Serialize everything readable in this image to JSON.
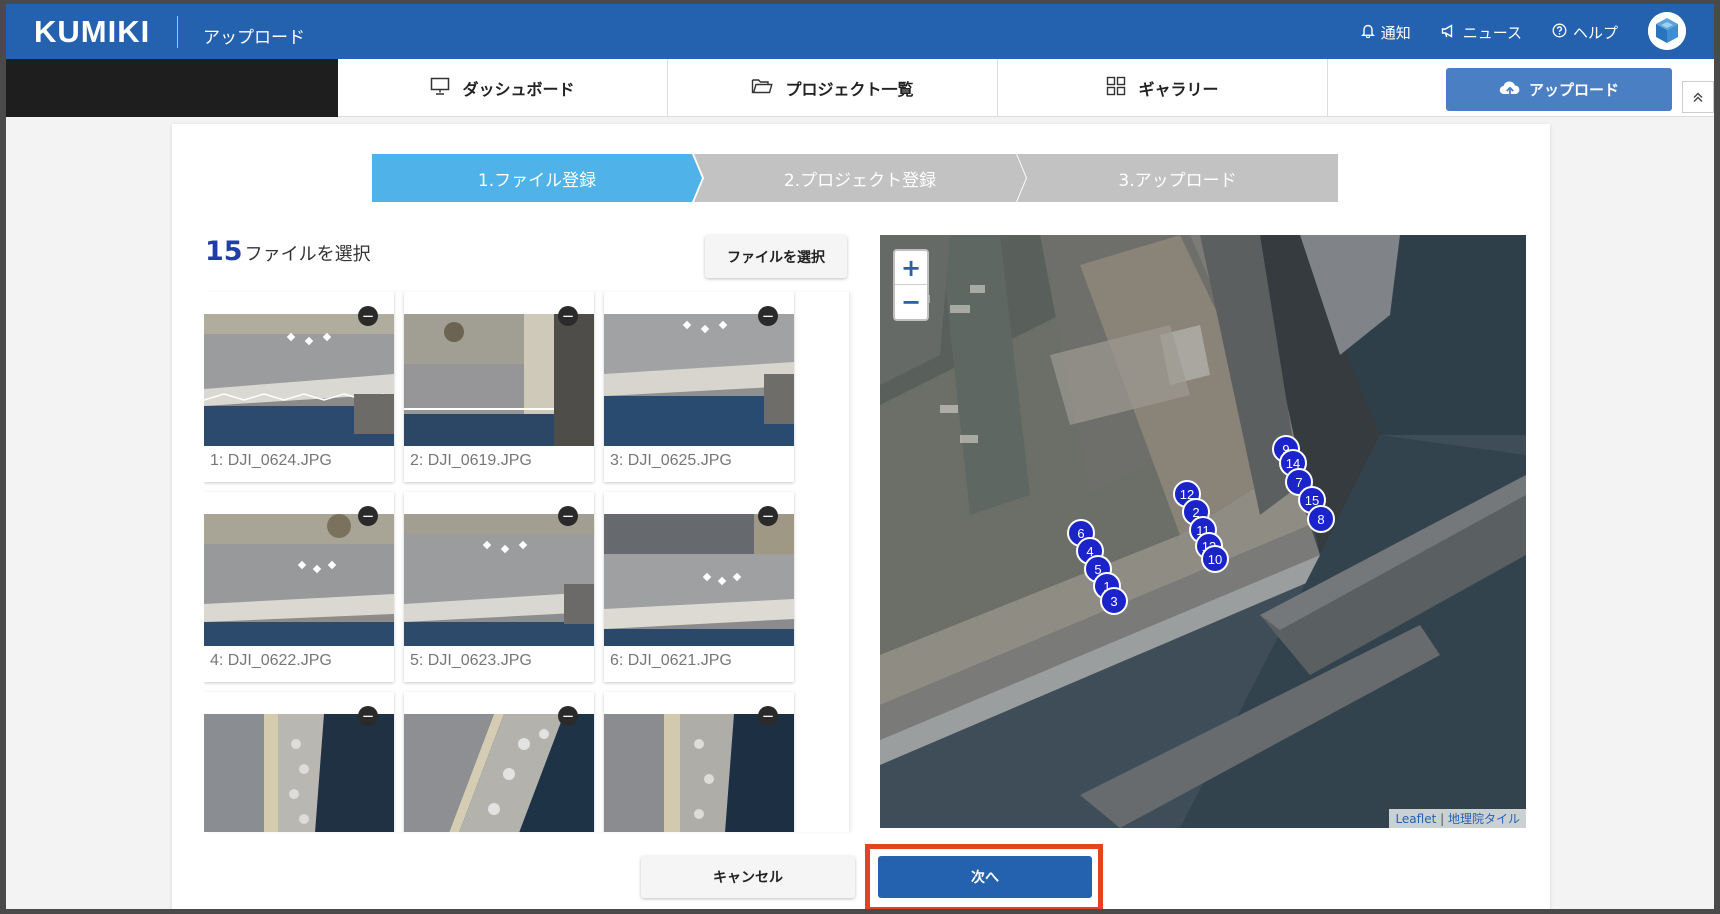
{
  "header": {
    "logo": "KUMIKI",
    "page_name": "アップロード",
    "links": [
      {
        "label": "通知",
        "icon": "bell-icon"
      },
      {
        "label": "ニュース",
        "icon": "megaphone-icon"
      },
      {
        "label": "ヘルプ",
        "icon": "help-circle-icon"
      }
    ]
  },
  "nav": {
    "tabs": [
      {
        "label": "ダッシュボード",
        "icon": "monitor-icon"
      },
      {
        "label": "プロジェクト一覧",
        "icon": "folder-icon"
      },
      {
        "label": "ギャラリー",
        "icon": "grid-icon"
      }
    ],
    "upload_label": "アップロード"
  },
  "steps": [
    {
      "label": "1.ファイル登録",
      "active": true
    },
    {
      "label": "2.プロジェクト登録",
      "active": false
    },
    {
      "label": "3.アップロード",
      "active": false
    }
  ],
  "files": {
    "count": "15",
    "count_suffix": "ファイルを選択",
    "select_button": "ファイルを選択",
    "items": [
      "1: DJI_0624.JPG",
      "2: DJI_0619.JPG",
      "3: DJI_0625.JPG",
      "4: DJI_0622.JPG",
      "5: DJI_0623.JPG",
      "6: DJI_0621.JPG",
      "",
      "",
      ""
    ]
  },
  "map": {
    "zoom_in": "+",
    "zoom_out": "−",
    "attribution_leaflet": "Leaflet",
    "attribution_sep": " | ",
    "attribution_tiles": "地理院タイル",
    "markers": [
      "9",
      "14",
      "7",
      "15",
      "8",
      "12",
      "2",
      "11",
      "13",
      "10",
      "6",
      "4",
      "5",
      "1",
      "3"
    ]
  },
  "actions": {
    "cancel": "キャンセル",
    "next": "次へ"
  },
  "colors": {
    "brand": "#2462b0",
    "step_active": "#4fb2e8",
    "step_inactive": "#c2c2c2",
    "marker": "#1b24c9",
    "highlight": "#e3431f"
  }
}
